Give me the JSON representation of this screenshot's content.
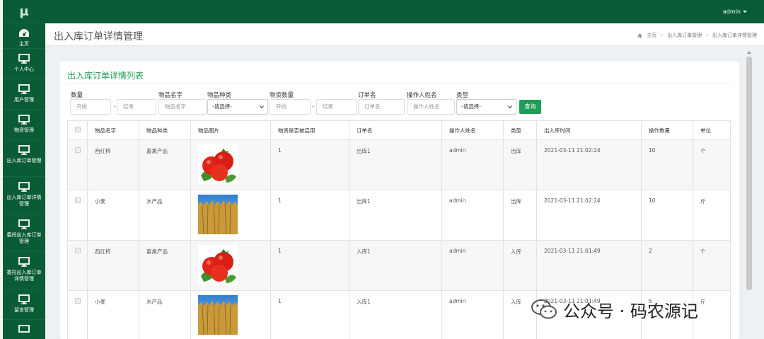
{
  "app": {
    "logo": "μ"
  },
  "topbar": {
    "user": "admin"
  },
  "sidebar": {
    "items": [
      {
        "label": "主页",
        "icon": "dashboard-icon"
      },
      {
        "label": "个人中心",
        "icon": "monitor-icon"
      },
      {
        "label": "用户管理",
        "icon": "monitor-icon"
      },
      {
        "label": "物资管理",
        "icon": "monitor-icon"
      },
      {
        "label": "出入库订单管理",
        "icon": "monitor-icon"
      },
      {
        "label": "出入库订单详情管理",
        "icon": "monitor-icon"
      },
      {
        "label": "委托出入库订单管理",
        "icon": "monitor-icon"
      },
      {
        "label": "委托出入库订单详情管理",
        "icon": "monitor-icon"
      },
      {
        "label": "留言管理",
        "icon": "monitor-icon"
      },
      {
        "label": "",
        "icon": "monitor-icon"
      }
    ]
  },
  "header": {
    "title": "出入库订单详情管理",
    "breadcrumb": [
      "主页",
      "出入库订单管理",
      "出入库订单详情管理"
    ]
  },
  "panel": {
    "title": "出入库订单详情列表"
  },
  "filters": {
    "quantity_label": "数量",
    "quantity_start": "开始",
    "quantity_end": "结束",
    "item_name_label": "物品名字",
    "item_name_placeholder": "物品名字",
    "item_type_label": "物品种类",
    "item_type_value": "-请选择-",
    "stock_qty_label": "物资数量",
    "stock_start": "开始",
    "stock_end": "结束",
    "order_name_label": "订单名",
    "order_name_placeholder": "订单名",
    "operator_label": "操作人姓名",
    "operator_placeholder": "操作人姓名",
    "type_label": "类型",
    "type_value": "-请选择-",
    "dash": "-",
    "search_button": "查询"
  },
  "table": {
    "headers": [
      "",
      "物品名字",
      "物品种类",
      "物品图片",
      "物资是否被启用",
      "订单名",
      "操作人姓名",
      "类型",
      "出入库时间",
      "操作数量",
      "单位"
    ],
    "rows": [
      {
        "name": "西红柿",
        "category": "畜禽产品",
        "image": "tomato",
        "enabled": "1",
        "order": "出库1",
        "operator": "admin",
        "type": "出库",
        "time": "2021-03-11 21:02:24",
        "qty": "10",
        "unit": "个"
      },
      {
        "name": "小麦",
        "category": "水产品",
        "image": "wheat",
        "enabled": "1",
        "order": "出库1",
        "operator": "admin",
        "type": "出库",
        "time": "2021-03-11 21:02:24",
        "qty": "10",
        "unit": "斤"
      },
      {
        "name": "西红柿",
        "category": "畜禽产品",
        "image": "tomato",
        "enabled": "1",
        "order": "入库1",
        "operator": "admin",
        "type": "入库",
        "time": "2021-03-11 21:01:49",
        "qty": "2",
        "unit": "个"
      },
      {
        "name": "小麦",
        "category": "水产品",
        "image": "wheat",
        "enabled": "1",
        "order": "入库1",
        "operator": "admin",
        "type": "入库",
        "time": "2021-03-11 21:01:49",
        "qty": "5",
        "unit": "斤"
      }
    ]
  },
  "watermark": {
    "text": "公众号 · 码农源记"
  },
  "colors": {
    "brand_green": "#0a5c36",
    "accent_green": "#1f9d55"
  }
}
